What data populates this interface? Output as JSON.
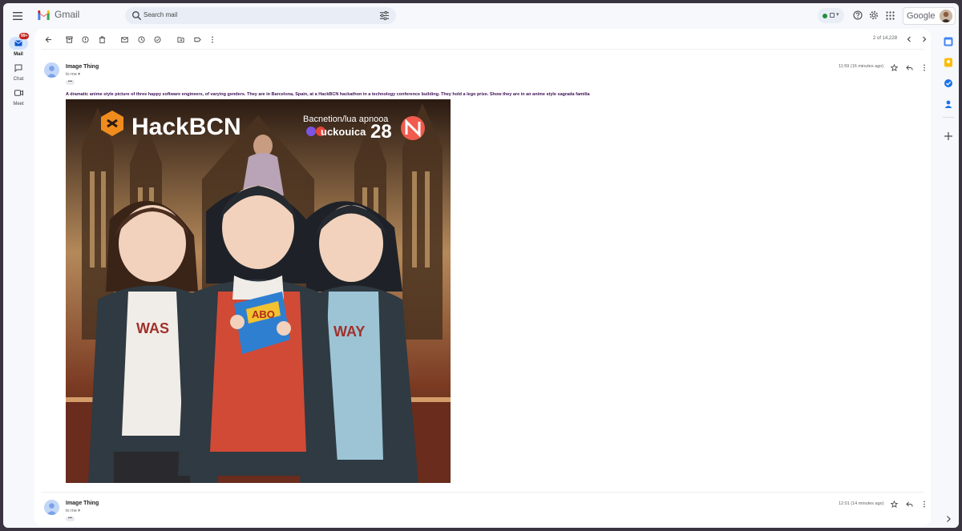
{
  "app": {
    "name": "Gmail"
  },
  "search": {
    "placeholder": "Search mail"
  },
  "account": {
    "brand": "Google"
  },
  "nav": {
    "items": [
      {
        "label": "Mail",
        "badge": "99+",
        "active": true
      },
      {
        "label": "Chat",
        "active": false
      },
      {
        "label": "Meet",
        "active": false
      }
    ]
  },
  "pager": {
    "text": "2 of 14,228"
  },
  "messages": [
    {
      "sender": "Image Thing",
      "to": "to me",
      "time": "11:59 (16 minutes ago)",
      "body": "A dramatic anime style picture of three happy software engineers, of varying genders. They are in Barcelona, Spain, at a HackBCN hackathon in a technology conference building. They hold a lego prize. Show they are in an anime style sagrada familia",
      "attachment": {
        "logo_text": "HackBCN",
        "banner_line1": "Bacnetion/lua apnooa",
        "banner_line2": "uckouica",
        "banner_number": "28",
        "box_text": "ABO",
        "shirt_text": "WAS",
        "shirt_text_right": "WAY"
      }
    },
    {
      "sender": "Image Thing",
      "to": "to me",
      "time": "12:01 (14 minutes ago)"
    }
  ],
  "colors": {
    "accent": "#0b57d0",
    "background": "#f6f8fc",
    "nav_active": "#d3e3fd",
    "badge": "#c5221f",
    "body_text": "#3c1054"
  }
}
